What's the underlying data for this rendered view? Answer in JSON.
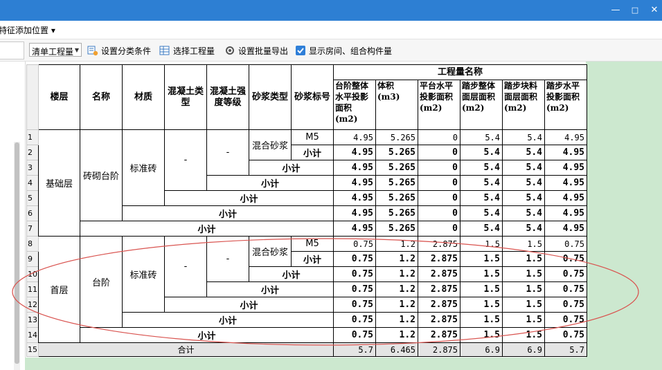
{
  "window": {
    "minimize": "—",
    "maximize": "□",
    "close": "✕"
  },
  "menu": {
    "partial_label": "特征添加位置 ▾"
  },
  "toolbar": {
    "dropdown_value": "清单工程量",
    "buttons": [
      {
        "label": "设置分类条件",
        "icon": "classify-settings-icon"
      },
      {
        "label": "选择工程量",
        "icon": "select-quantity-icon"
      },
      {
        "label": "设置批量导出",
        "icon": "batch-export-icon"
      },
      {
        "label": "显示房间、组合构件量",
        "icon": "checkbox-checked-icon",
        "checked": true
      }
    ]
  },
  "table": {
    "headers": {
      "floor": "楼层",
      "name": "名称",
      "material": "材质",
      "concrete_type": "混凝土类型",
      "concrete_grade": "混凝土强度等级",
      "mortar_type": "砂浆类型",
      "mortar_grade": "砂浆标号",
      "quantity_group": "工程量名称",
      "q1": "台阶整体水平投影面积(m2)",
      "q2": "体积(m3)",
      "q3": "平台水平投影面积(m2)",
      "q4": "踏步整体面层面积(m2)",
      "q5": "踏步块料面层面积(m2)",
      "q6": "踏步水平投影面积(m2)"
    },
    "row_numbers": [
      "1",
      "2",
      "3",
      "4",
      "5",
      "6",
      "7",
      "8",
      "9",
      "10",
      "11",
      "12",
      "13",
      "14",
      "15"
    ],
    "groups": [
      {
        "floor": "基础层",
        "name": "砖砌台阶",
        "material": "标准砖",
        "concrete_type": "-",
        "concrete_grade": "-",
        "mortar_type": "混合砂浆",
        "mortar_grade": "M5"
      },
      {
        "floor": "首层",
        "name": "台阶",
        "material": "标准砖",
        "concrete_type": "-",
        "concrete_grade": "-",
        "mortar_type": "混合砂浆",
        "mortar_grade": "M5"
      }
    ],
    "subtotal_label": "小计",
    "total_label": "合计",
    "values": [
      [
        "4.95",
        "5.265",
        "0",
        "5.4",
        "5.4",
        "4.95"
      ],
      [
        "4.95",
        "5.265",
        "0",
        "5.4",
        "5.4",
        "4.95"
      ],
      [
        "4.95",
        "5.265",
        "0",
        "5.4",
        "5.4",
        "4.95"
      ],
      [
        "4.95",
        "5.265",
        "0",
        "5.4",
        "5.4",
        "4.95"
      ],
      [
        "4.95",
        "5.265",
        "0",
        "5.4",
        "5.4",
        "4.95"
      ],
      [
        "4.95",
        "5.265",
        "0",
        "5.4",
        "5.4",
        "4.95"
      ],
      [
        "4.95",
        "5.265",
        "0",
        "5.4",
        "5.4",
        "4.95"
      ],
      [
        "0.75",
        "1.2",
        "2.875",
        "1.5",
        "1.5",
        "0.75"
      ],
      [
        "0.75",
        "1.2",
        "2.875",
        "1.5",
        "1.5",
        "0.75"
      ],
      [
        "0.75",
        "1.2",
        "2.875",
        "1.5",
        "1.5",
        "0.75"
      ],
      [
        "0.75",
        "1.2",
        "2.875",
        "1.5",
        "1.5",
        "0.75"
      ],
      [
        "0.75",
        "1.2",
        "2.875",
        "1.5",
        "1.5",
        "0.75"
      ],
      [
        "0.75",
        "1.2",
        "2.875",
        "1.5",
        "1.5",
        "0.75"
      ],
      [
        "0.75",
        "1.2",
        "2.875",
        "1.5",
        "1.5",
        "0.75"
      ],
      [
        "5.7",
        "6.465",
        "2.875",
        "6.9",
        "6.9",
        "5.7"
      ]
    ]
  },
  "colors": {
    "titlebar": "#2d7fd3",
    "green_bg": "#cce8cf",
    "ellipse": "#d9534f"
  }
}
